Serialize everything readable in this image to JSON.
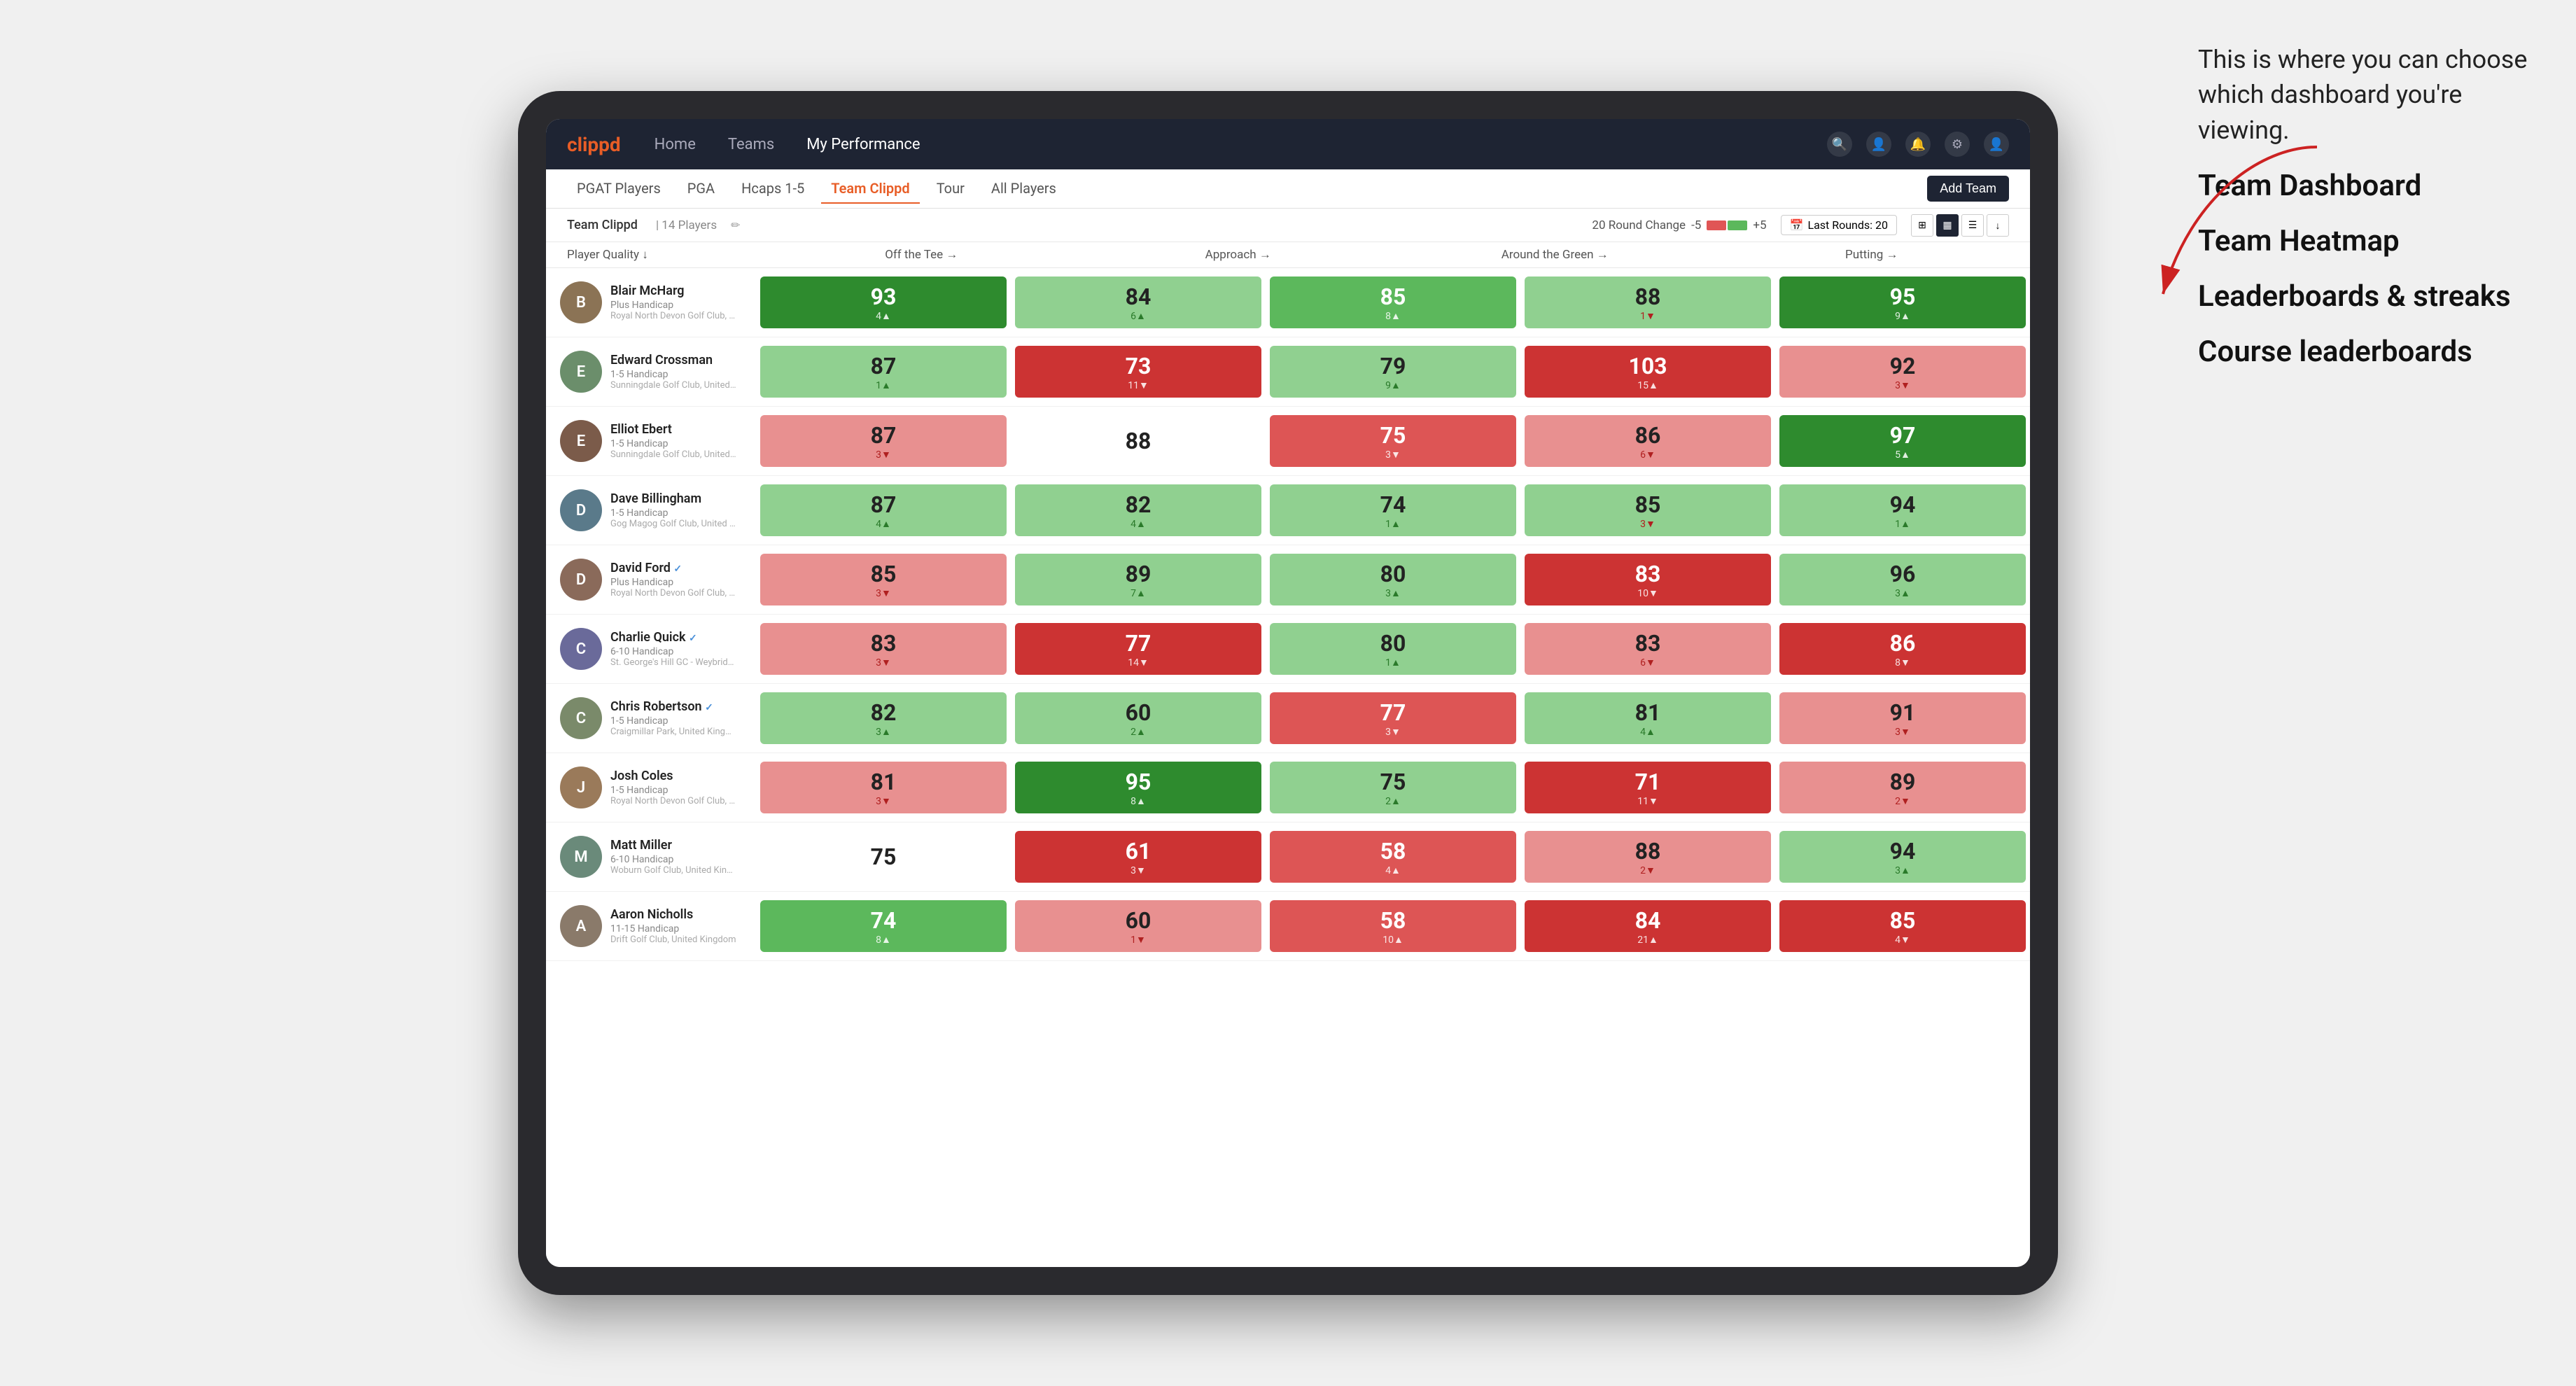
{
  "annotation": {
    "intro_text": "This is where you can choose which dashboard you're viewing.",
    "options": [
      "Team Dashboard",
      "Team Heatmap",
      "Leaderboards & streaks",
      "Course leaderboards"
    ]
  },
  "navbar": {
    "logo": "clippd",
    "links": [
      "Home",
      "Teams",
      "My Performance"
    ],
    "active_link": "My Performance"
  },
  "tabs": {
    "items": [
      "PGAT Players",
      "PGA",
      "Hcaps 1-5",
      "Team Clippd",
      "Tour",
      "All Players"
    ],
    "active": "Team Clippd",
    "add_button": "Add Team"
  },
  "toolbar": {
    "team_label": "Team Clippd",
    "player_count": "14 Players",
    "round_change_label": "20 Round Change",
    "round_change_neg": "-5",
    "round_change_pos": "+5",
    "last_rounds_label": "Last Rounds:",
    "last_rounds_value": "20"
  },
  "table": {
    "column_headers": [
      "Player Quality ↓",
      "Off the Tee →",
      "Approach →",
      "Around the Green →",
      "Putting →"
    ],
    "players": [
      {
        "name": "Blair McHarg",
        "handicap": "Plus Handicap",
        "club": "Royal North Devon Golf Club, United Kingdom",
        "avatar_color": "#8B7355",
        "avatar_initial": "B",
        "metrics": [
          {
            "value": "93",
            "change": "4",
            "dir": "up",
            "color": "dark-green"
          },
          {
            "value": "84",
            "change": "6",
            "dir": "up",
            "color": "light-green"
          },
          {
            "value": "85",
            "change": "8",
            "dir": "up",
            "color": "medium-green"
          },
          {
            "value": "88",
            "change": "1",
            "dir": "down",
            "color": "light-green"
          },
          {
            "value": "95",
            "change": "9",
            "dir": "up",
            "color": "dark-green"
          }
        ]
      },
      {
        "name": "Edward Crossman",
        "handicap": "1-5 Handicap",
        "club": "Sunningdale Golf Club, United Kingdom",
        "avatar_color": "#6B8E6B",
        "avatar_initial": "E",
        "metrics": [
          {
            "value": "87",
            "change": "1",
            "dir": "up",
            "color": "light-green"
          },
          {
            "value": "73",
            "change": "11",
            "dir": "down",
            "color": "dark-red"
          },
          {
            "value": "79",
            "change": "9",
            "dir": "up",
            "color": "light-green"
          },
          {
            "value": "103",
            "change": "15",
            "dir": "up",
            "color": "dark-red"
          },
          {
            "value": "92",
            "change": "3",
            "dir": "down",
            "color": "light-red"
          }
        ]
      },
      {
        "name": "Elliot Ebert",
        "handicap": "1-5 Handicap",
        "club": "Sunningdale Golf Club, United Kingdom",
        "avatar_color": "#7B5B4A",
        "avatar_initial": "E",
        "metrics": [
          {
            "value": "87",
            "change": "3",
            "dir": "down",
            "color": "light-red"
          },
          {
            "value": "88",
            "change": "",
            "dir": "none",
            "color": "white"
          },
          {
            "value": "75",
            "change": "3",
            "dir": "down",
            "color": "medium-red"
          },
          {
            "value": "86",
            "change": "6",
            "dir": "down",
            "color": "light-red"
          },
          {
            "value": "97",
            "change": "5",
            "dir": "up",
            "color": "dark-green"
          }
        ]
      },
      {
        "name": "Dave Billingham",
        "handicap": "1-5 Handicap",
        "club": "Gog Magog Golf Club, United Kingdom",
        "avatar_color": "#5A7A8A",
        "avatar_initial": "D",
        "metrics": [
          {
            "value": "87",
            "change": "4",
            "dir": "up",
            "color": "light-green"
          },
          {
            "value": "82",
            "change": "4",
            "dir": "up",
            "color": "light-green"
          },
          {
            "value": "74",
            "change": "1",
            "dir": "up",
            "color": "light-green"
          },
          {
            "value": "85",
            "change": "3",
            "dir": "down",
            "color": "light-green"
          },
          {
            "value": "94",
            "change": "1",
            "dir": "up",
            "color": "light-green"
          }
        ]
      },
      {
        "name": "David Ford",
        "handicap": "Plus Handicap",
        "club": "Royal North Devon Golf Club, United Kingdom",
        "verified": true,
        "avatar_color": "#8A6A5A",
        "avatar_initial": "D",
        "metrics": [
          {
            "value": "85",
            "change": "3",
            "dir": "down",
            "color": "light-red"
          },
          {
            "value": "89",
            "change": "7",
            "dir": "up",
            "color": "light-green"
          },
          {
            "value": "80",
            "change": "3",
            "dir": "up",
            "color": "light-green"
          },
          {
            "value": "83",
            "change": "10",
            "dir": "down",
            "color": "dark-red"
          },
          {
            "value": "96",
            "change": "3",
            "dir": "up",
            "color": "light-green"
          }
        ]
      },
      {
        "name": "Charlie Quick",
        "handicap": "6-10 Handicap",
        "club": "St. George's Hill GC - Weybridge - Surrey, Uni...",
        "verified": true,
        "avatar_color": "#6A6A9A",
        "avatar_initial": "C",
        "metrics": [
          {
            "value": "83",
            "change": "3",
            "dir": "down",
            "color": "light-red"
          },
          {
            "value": "77",
            "change": "14",
            "dir": "down",
            "color": "dark-red"
          },
          {
            "value": "80",
            "change": "1",
            "dir": "up",
            "color": "light-green"
          },
          {
            "value": "83",
            "change": "6",
            "dir": "down",
            "color": "light-red"
          },
          {
            "value": "86",
            "change": "8",
            "dir": "down",
            "color": "dark-red"
          }
        ]
      },
      {
        "name": "Chris Robertson",
        "handicap": "1-5 Handicap",
        "club": "Craigmillar Park, United Kingdom",
        "verified": true,
        "avatar_color": "#7A8A6A",
        "avatar_initial": "C",
        "metrics": [
          {
            "value": "82",
            "change": "3",
            "dir": "up",
            "color": "light-green"
          },
          {
            "value": "60",
            "change": "2",
            "dir": "up",
            "color": "light-green"
          },
          {
            "value": "77",
            "change": "3",
            "dir": "down",
            "color": "medium-red"
          },
          {
            "value": "81",
            "change": "4",
            "dir": "up",
            "color": "light-green"
          },
          {
            "value": "91",
            "change": "3",
            "dir": "down",
            "color": "light-red"
          }
        ]
      },
      {
        "name": "Josh Coles",
        "handicap": "1-5 Handicap",
        "club": "Royal North Devon Golf Club, United Kingdom",
        "avatar_color": "#9A7A5A",
        "avatar_initial": "J",
        "metrics": [
          {
            "value": "81",
            "change": "3",
            "dir": "down",
            "color": "light-red"
          },
          {
            "value": "95",
            "change": "8",
            "dir": "up",
            "color": "dark-green"
          },
          {
            "value": "75",
            "change": "2",
            "dir": "up",
            "color": "light-green"
          },
          {
            "value": "71",
            "change": "11",
            "dir": "down",
            "color": "dark-red"
          },
          {
            "value": "89",
            "change": "2",
            "dir": "down",
            "color": "light-red"
          }
        ]
      },
      {
        "name": "Matt Miller",
        "handicap": "6-10 Handicap",
        "club": "Woburn Golf Club, United Kingdom",
        "avatar_color": "#6A8A7A",
        "avatar_initial": "M",
        "metrics": [
          {
            "value": "75",
            "change": "",
            "dir": "none",
            "color": "white"
          },
          {
            "value": "61",
            "change": "3",
            "dir": "down",
            "color": "dark-red"
          },
          {
            "value": "58",
            "change": "4",
            "dir": "up",
            "color": "medium-red"
          },
          {
            "value": "88",
            "change": "2",
            "dir": "down",
            "color": "light-red"
          },
          {
            "value": "94",
            "change": "3",
            "dir": "up",
            "color": "light-green"
          }
        ]
      },
      {
        "name": "Aaron Nicholls",
        "handicap": "11-15 Handicap",
        "club": "Drift Golf Club, United Kingdom",
        "avatar_color": "#8A7A6A",
        "avatar_initial": "A",
        "metrics": [
          {
            "value": "74",
            "change": "8",
            "dir": "up",
            "color": "medium-green"
          },
          {
            "value": "60",
            "change": "1",
            "dir": "down",
            "color": "light-red"
          },
          {
            "value": "58",
            "change": "10",
            "dir": "up",
            "color": "medium-red"
          },
          {
            "value": "84",
            "change": "21",
            "dir": "up",
            "color": "dark-red"
          },
          {
            "value": "85",
            "change": "4",
            "dir": "down",
            "color": "dark-red"
          }
        ]
      }
    ]
  }
}
